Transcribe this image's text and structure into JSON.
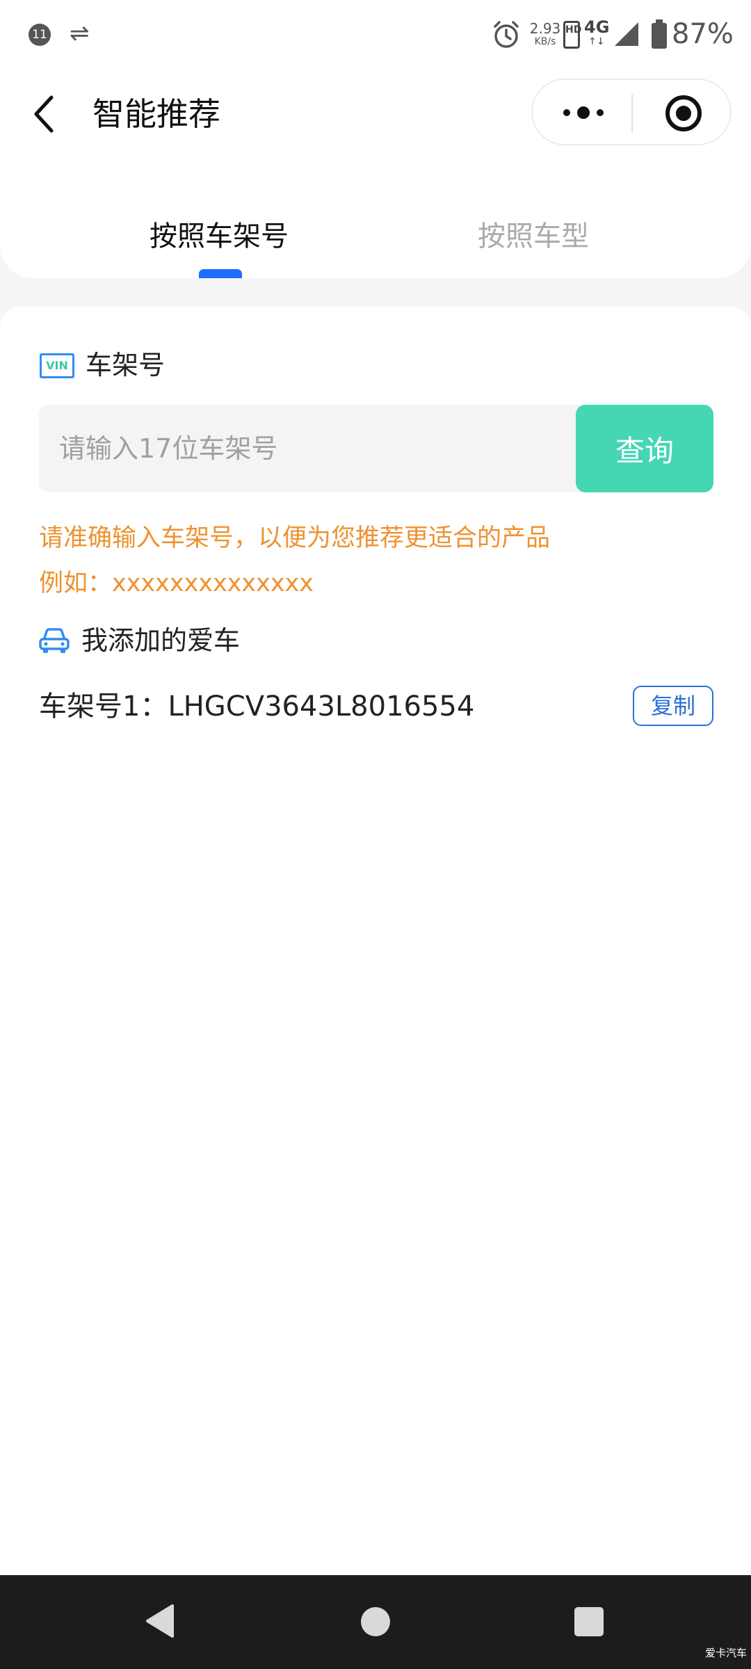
{
  "status_bar": {
    "notification_count": "11",
    "transfer_icon": "⇌",
    "net_speed_value": "2.93",
    "net_speed_unit": "KB/s",
    "hd_badge": "HD",
    "network_type": "4G",
    "network_arrows": "↑↓",
    "battery_percent": "87%"
  },
  "header": {
    "title": "智能推荐",
    "tabs": [
      {
        "label": "按照车架号",
        "active": true
      },
      {
        "label": "按照车型",
        "active": false
      }
    ]
  },
  "vin_section": {
    "icon_text": "VIN",
    "label": "车架号",
    "input_placeholder": "请输入17位车架号",
    "input_value": "",
    "query_button": "查询",
    "hint_line_1": "请准确输入车架号，以便为您推荐更适合的产品",
    "hint_line_2": "例如：xxxxxxxxxxxxxx"
  },
  "my_cars": {
    "label": "我添加的爱车",
    "items": [
      {
        "label": "车架号1：LHGCV3643L8016554",
        "copy_button": "复制"
      }
    ]
  },
  "watermark": "爱卡汽车",
  "colors": {
    "accent_blue": "#1a6dff",
    "query_green": "#45d6b4",
    "hint_orange": "#ee9230",
    "copy_blue": "#2a6fd6"
  }
}
